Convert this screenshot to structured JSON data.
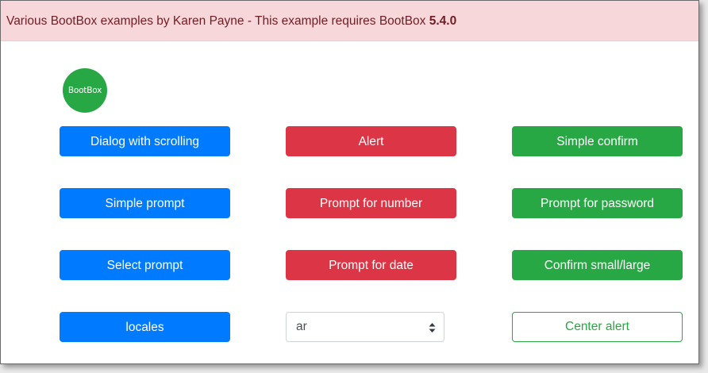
{
  "banner": {
    "text": "Various BootBox examples by Karen Payne - This example requires BootBox ",
    "version": "5.4.0"
  },
  "logo": {
    "label": "BootBox"
  },
  "buttons": {
    "dialog_with_scrolling": "Dialog with scrolling",
    "alert": "Alert",
    "simple_confirm": "Simple confirm",
    "simple_prompt": "Simple prompt",
    "prompt_for_number": "Prompt for number",
    "prompt_for_password": "Prompt for password",
    "select_prompt": "Select prompt",
    "prompt_for_date": "Prompt for date",
    "confirm_small_large": "Confirm small/large",
    "locales": "locales",
    "center_alert": "Center alert"
  },
  "locale_select": {
    "value": "ar"
  },
  "colors": {
    "primary": "#007bff",
    "danger": "#dc3545",
    "success": "#28a745",
    "banner_bg": "#f8d7da",
    "banner_text": "#721c24"
  }
}
